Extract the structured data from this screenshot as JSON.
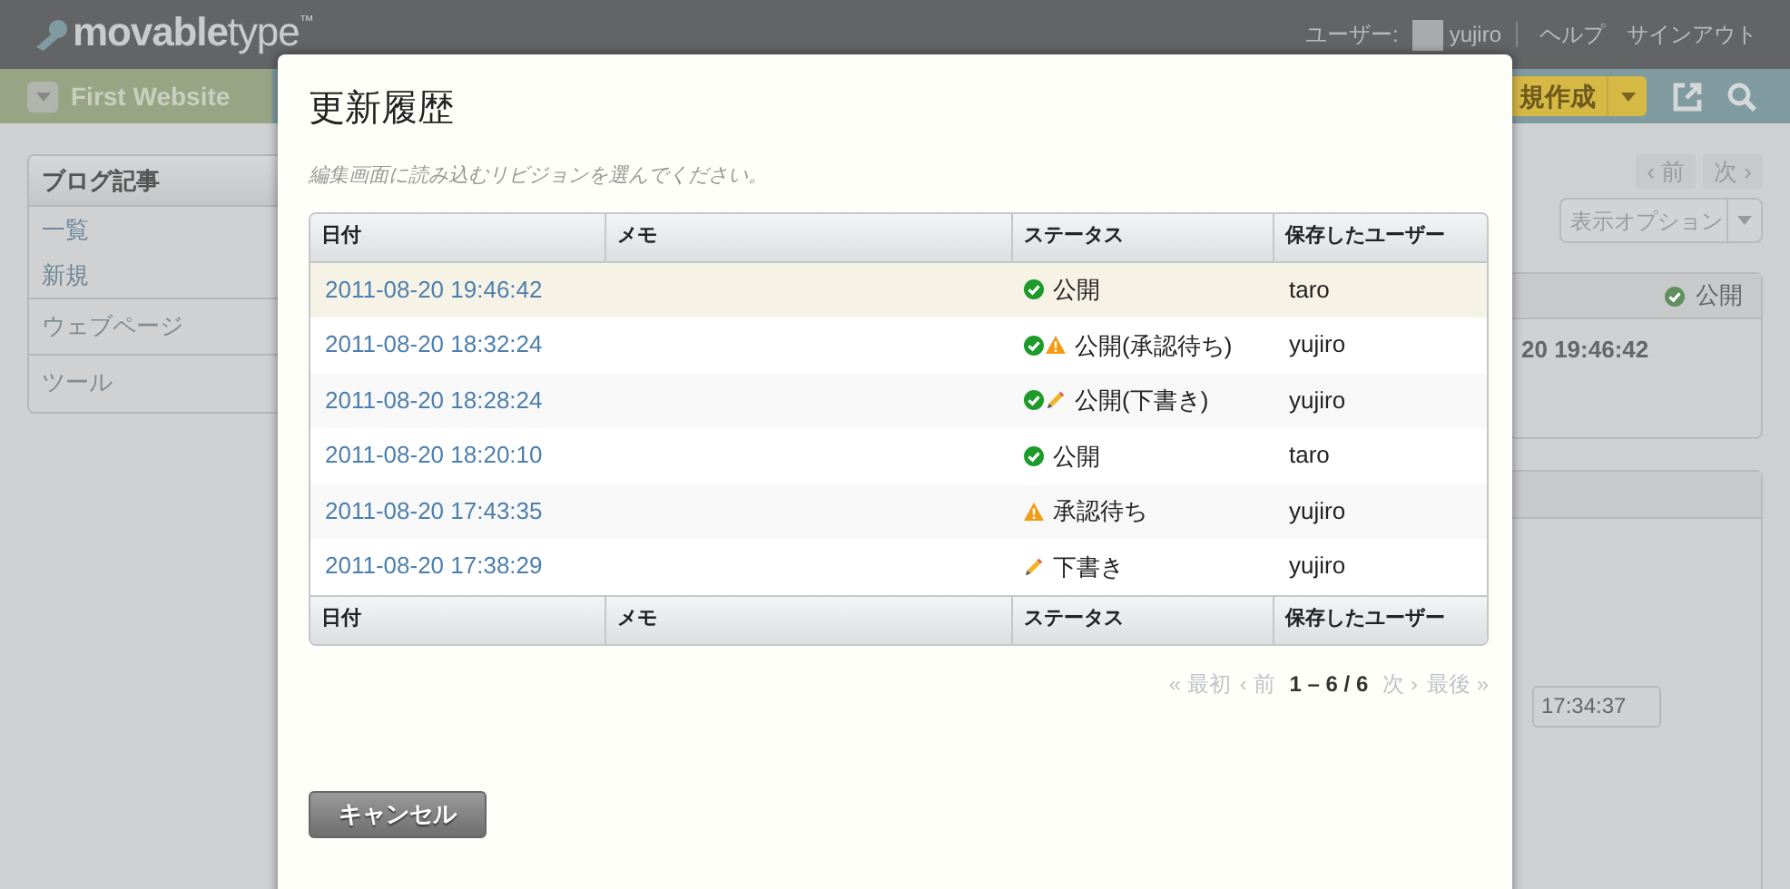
{
  "header": {
    "logo": "**movable**type",
    "trademark": "™",
    "user_label": "ユーザー:",
    "username": "yujiro",
    "links": [
      "ヘルプ",
      "サインアウト"
    ]
  },
  "nav": {
    "site": "First Website",
    "create_button": "規作成"
  },
  "sidebar": {
    "sections": [
      {
        "title": "ブログ記事",
        "items": [
          "一覧",
          "新規"
        ]
      },
      {
        "title": "ウェブページ"
      },
      {
        "title": "ツール"
      }
    ]
  },
  "pager_buttons": [
    "‹ 前",
    "次 ›"
  ],
  "display_options": "表示オプション",
  "entry_panel": {
    "status": "公開",
    "date": "20 19:46:42"
  },
  "time_field": {
    "value": "17:34:37"
  },
  "dialog": {
    "title": "更新履歴",
    "hint": "編集画面に読み込むリビジョンを選んでください。",
    "columns": [
      "日付",
      "メモ",
      "ステータス",
      "保存したユーザー"
    ],
    "rows": [
      {
        "date": "2011-08-20 19:46:42",
        "status_icons": [
          {
            "kind": "check"
          }
        ],
        "status": "公開",
        "user": "taro",
        "selected": true
      },
      {
        "date": "2011-08-20 18:32:24",
        "status_icons": [
          {
            "kind": "check"
          },
          {
            "kind": "warning"
          }
        ],
        "status": "公開(承認待ち)",
        "user": "yujiro",
        "selected": false
      },
      {
        "date": "2011-08-20 18:28:24",
        "status_icons": [
          {
            "kind": "check"
          },
          {
            "kind": "pencil"
          }
        ],
        "status": "公開(下書き)",
        "user": "yujiro",
        "selected": false
      },
      {
        "date": "2011-08-20 18:20:10",
        "status_icons": [
          {
            "kind": "check"
          }
        ],
        "status": "公開",
        "user": "taro",
        "selected": false
      },
      {
        "date": "2011-08-20 17:43:35",
        "status_icons": [
          {
            "kind": "warning"
          }
        ],
        "status": "承認待ち",
        "user": "yujiro",
        "selected": false
      },
      {
        "date": "2011-08-20 17:38:29",
        "status_icons": [
          {
            "kind": "pencil"
          }
        ],
        "status": "下書き",
        "user": "yujiro",
        "selected": false
      }
    ],
    "footer_columns": [
      "日付",
      "メモ",
      "ステータス",
      "保存したユーザー"
    ],
    "pagination": [
      {
        "label": "« 最初",
        "kind": "link",
        "disabled": true
      },
      {
        "label": "‹ 前",
        "kind": "link",
        "disabled": true
      },
      {
        "label": "1 – 6 / 6",
        "kind": "range",
        "disabled": false
      },
      {
        "label": "次 ›",
        "kind": "link",
        "disabled": true
      },
      {
        "label": "最後 »",
        "kind": "link",
        "disabled": true
      }
    ],
    "cancel": "キャンセル"
  }
}
